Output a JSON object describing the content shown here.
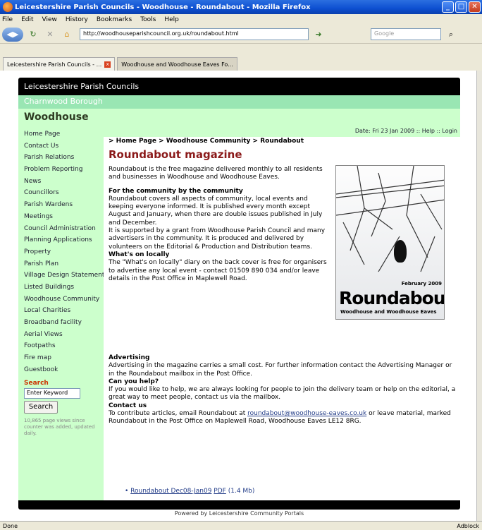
{
  "browser": {
    "window_title": "Leicestershire Parish Councils - Woodhouse - Roundabout - Mozilla Firefox",
    "menu": [
      "File",
      "Edit",
      "View",
      "History",
      "Bookmarks",
      "Tools",
      "Help"
    ],
    "url": "http://woodhouseparishcouncil.org.uk/roundabout.html",
    "search_placeholder": "Google",
    "tabs": [
      {
        "label": "Leicestershire Parish Councils - ...",
        "active": true
      },
      {
        "label": "Woodhouse and Woodhouse Eaves Fo...",
        "active": false
      }
    ],
    "status_left": "Done",
    "status_right": "Adblock"
  },
  "site": {
    "header_title": "Leicestershire Parish Councils",
    "borough": "Charnwood Borough",
    "parish": "Woodhouse",
    "date_line": "Date: Fri 23 Jan 2009 :: Help :: Login",
    "nav": [
      "Home Page",
      "Contact Us",
      "Parish Relations",
      "Problem Reporting",
      "News",
      "Councillors",
      "Parish Wardens",
      "Meetings",
      "Council Administration",
      "Planning Applications",
      "Property",
      "Parish Plan",
      "Village Design Statements",
      "Listed Buildings",
      "Woodhouse Community",
      "Local Charities",
      "Broadband facility",
      "Aerial Views",
      "Footpaths",
      "Fire map",
      "Guestbook"
    ],
    "search_label": "Search",
    "keyword_value": "Enter Keyword",
    "search_button": "Search",
    "counter_text": "10,865 page views since counter was added, updated daily.",
    "footer_text": "Powered by Leicestershire Community Portals"
  },
  "page": {
    "breadcrumb": "> Home Page > Woodhouse Community > Roundabout",
    "title": "Roundabout magazine",
    "intro": "Roundabout is the free magazine delivered monthly to all residents and businesses in Woodhouse and Woodhouse Eaves.",
    "community_heading": "For the community by the community",
    "community_text": "Roundabout covers all aspects of community, local events and keeping everyone informed. It is published every month except August and January, when there are double issues published in July and December.",
    "support_text": "It is supported by a grant from Woodhouse Parish Council and many advertisers in the community. It is produced and delivered by volunteers on the Editorial & Production and Distribution teams.",
    "local_heading": "What's on locally",
    "local_text": "The \"What's on locally\" diary on the back cover is free for organisers to advertise any local event - contact 01509 890 034 and/or leave details in the Post Office in Maplewell Road.",
    "advertising_heading": "Advertising",
    "advertising_text": "Advertising in the magazine carries a small cost. For further information contact the Advertising Manager or in the Roundabout mailbox in the Post Office.",
    "help_heading": "Can you help?",
    "help_text": "If you would like to help, we are always looking for people to join the delivery team or help on the editorial, a great way to meet people, contact us via the mailbox.",
    "contact_heading": "Contact us",
    "contact_text_pre": "To contribute articles, email Roundabout at ",
    "contact_email": "roundabout@woodhouse-eaves.co.uk",
    "contact_text_post": " or leave material, marked Roundabout in the Post Office on Maplewell Road, Woodhouse Eaves LE12 8RG.",
    "pdf_link": "Roundabout Dec08-Jan09",
    "pdf_type": "PDF",
    "pdf_size": "(1.4 Mb)",
    "cover_month": "February 2009",
    "cover_title": "Roundabout",
    "cover_strap": "Woodhouse and Woodhouse Eaves"
  }
}
